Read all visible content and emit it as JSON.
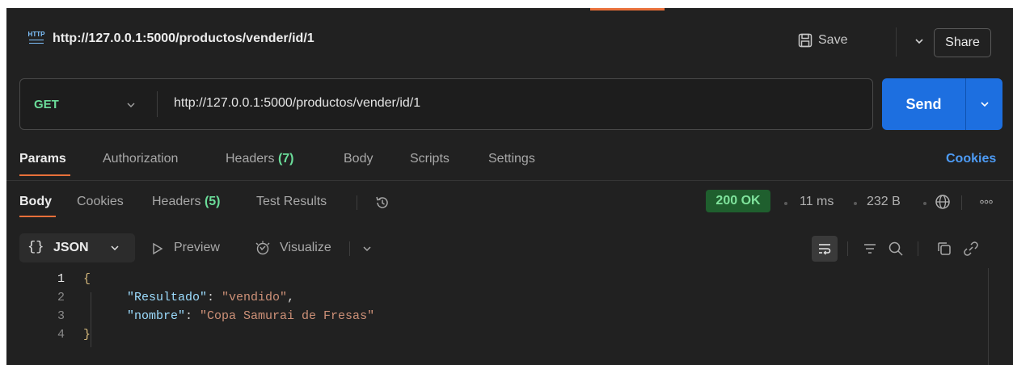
{
  "request": {
    "title": "http://127.0.0.1:5000/productos/vender/id/1",
    "http_badge": "HTTP",
    "save_label": "Save",
    "share_label": "Share",
    "method": "GET",
    "url": "http://127.0.0.1:5000/productos/vender/id/1",
    "send_label": "Send"
  },
  "request_tabs": [
    {
      "label": "Params"
    },
    {
      "label": "Authorization"
    },
    {
      "label": "Headers",
      "count": "(7)"
    },
    {
      "label": "Body"
    },
    {
      "label": "Scripts"
    },
    {
      "label": "Settings"
    }
  ],
  "cookies_link": "Cookies",
  "response_tabs": [
    {
      "label": "Body"
    },
    {
      "label": "Cookies"
    },
    {
      "label": "Headers",
      "count": "(5)"
    },
    {
      "label": "Test Results"
    }
  ],
  "status": {
    "code": "200 OK",
    "time": "11 ms",
    "size": "232 B"
  },
  "toolbar": {
    "format_braces": "{}",
    "format_label": "JSON",
    "preview_label": "Preview",
    "visualize_label": "Visualize"
  },
  "code_lines": [
    {
      "num": "1",
      "text": "{"
    },
    {
      "num": "2",
      "key": "\"Resultado\"",
      "sep": ": ",
      "value": "\"vendido\"",
      "tail": ","
    },
    {
      "num": "3",
      "key": "\"nombre\"",
      "sep": ": ",
      "value": "\"Copa Samurai de Fresas\"",
      "tail": ""
    },
    {
      "num": "4",
      "text": "}"
    }
  ],
  "colors": {
    "background": "#212121",
    "accent": "#e8703a",
    "send_button": "#1d6fe0",
    "method_get": "#6bdd9a",
    "status_ok_bg": "#1f5f2e",
    "link": "#4d9bf5"
  },
  "icons": [
    "http-icon",
    "save-icon",
    "chevron-down-icon",
    "history-icon",
    "globe-icon",
    "more-icon",
    "play-icon",
    "visualize-icon",
    "wrap-icon",
    "filter-icon",
    "search-icon",
    "copy-icon",
    "link-icon"
  ]
}
